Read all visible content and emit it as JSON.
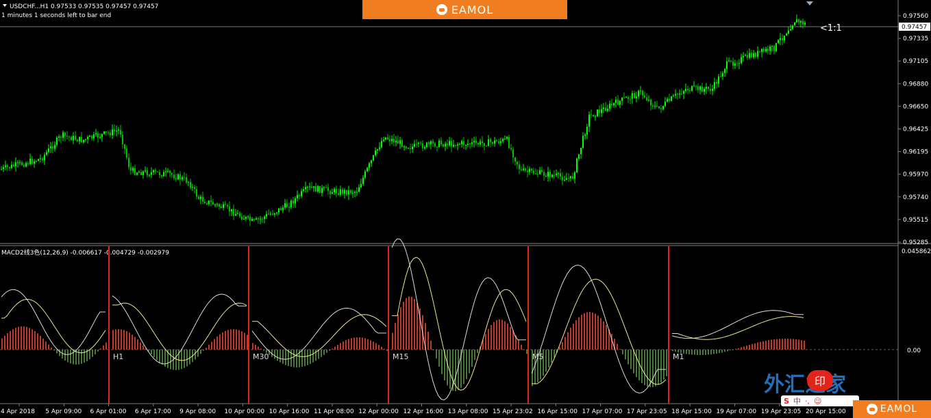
{
  "header": {
    "symbol_line": "USDCHF...H1  0.97533 0.97535 0.97457 0.97457",
    "timer": "1 minutes 1 seconds left to bar end"
  },
  "banner": {
    "brand": "EAMOL",
    "brand_bottom": "EAMOL"
  },
  "price_pane": {
    "current_price": "0.97457",
    "shift_label": "<1:1",
    "ticks": [
      "0.97560",
      "0.97335",
      "0.97105",
      "0.96880",
      "0.96650",
      "0.96425",
      "0.96195",
      "0.95970",
      "0.95740",
      "0.95515",
      "0.95285"
    ]
  },
  "macd_pane": {
    "title": "MACD2线3色(12,26,9) -0.006617 -0.004729 -0.002979",
    "tick_top": "0.045862",
    "tick_zero": "0.00",
    "tick_zero_right": "0.00",
    "timeframe_labels": [
      "H1",
      "M30",
      "M15",
      "M5",
      "M1"
    ]
  },
  "time_axis": [
    "4 Apr 2018",
    "5 Apr 09:00",
    "6 Apr 01:00",
    "6 Apr 17:00",
    "9 Apr 08:00",
    "10 Apr 00:00",
    "10 Apr 16:00",
    "11 Apr 08:00",
    "12 Apr 00:00",
    "12 Apr 16:00",
    "13 Apr 08:00",
    "15 Apr 23:02",
    "16 Apr 15:00",
    "17 Apr 07:00",
    "17 Apr 23:05",
    "18 Apr 15:00",
    "19 Apr 07:00",
    "19 Apr 23:05",
    "20 Apr 15:00"
  ],
  "watermark": {
    "site": "外汇之家",
    "badge": "印",
    "ime": "中"
  },
  "colors": {
    "bull": "#00ff00",
    "bear": "#00c000",
    "macd_pos": "#c0392b",
    "macd_neg": "#4a7a3a",
    "divider": "#e3241b",
    "line_white": "#dcdcdc",
    "line_yellow": "#f0e68c",
    "grid": "#808080"
  }
}
